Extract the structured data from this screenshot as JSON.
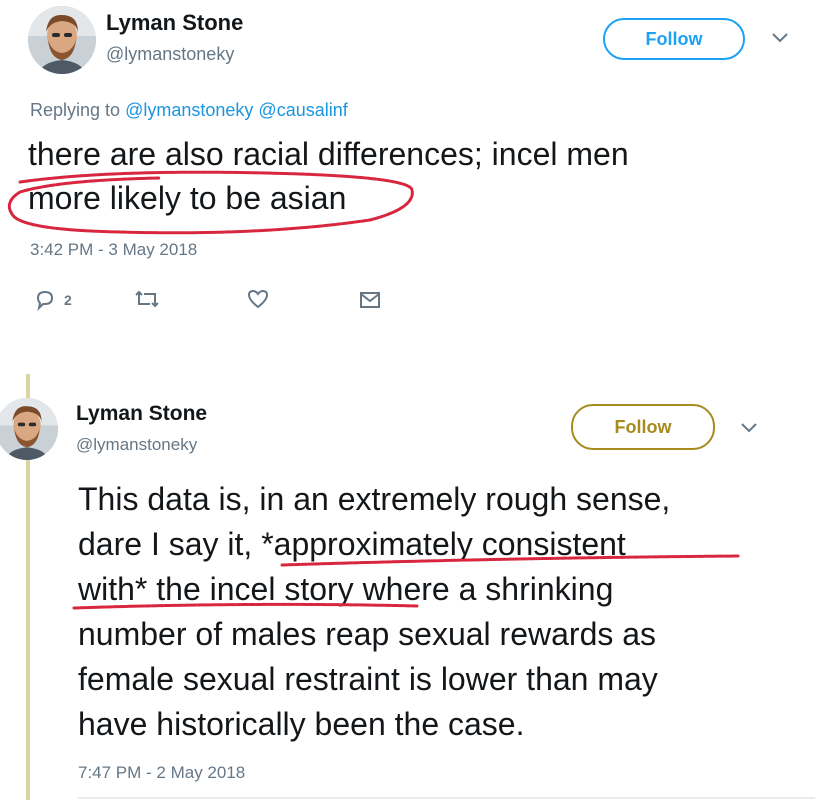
{
  "tweet1": {
    "name": "Lyman Stone",
    "handle": "@lymanstoneky",
    "follow_label": "Follow",
    "replying_prefix": "Replying to",
    "replying_to": [
      "@lymanstoneky",
      "@causalinf"
    ],
    "text_lines": [
      "there are also racial differences; incel men",
      "more likely to be asian"
    ],
    "timestamp": "3:42 PM - 3 May 2018",
    "reply_count": "2",
    "follow_color": "#1da1f2"
  },
  "tweet2": {
    "name": "Lyman Stone",
    "handle": "@lymanstoneky",
    "follow_label": "Follow",
    "text_lines": [
      "This data is, in an extremely rough sense,",
      "dare I say it, *approximately consistent",
      "with* the incel story where a shrinking",
      "number of males reap sexual rewards as",
      "female sexual restraint is lower than may",
      "have historically been the case."
    ],
    "timestamp": "7:47 PM - 2 May 2018",
    "follow_color": "#a78b1f"
  },
  "annotation_color": "#d7263d"
}
